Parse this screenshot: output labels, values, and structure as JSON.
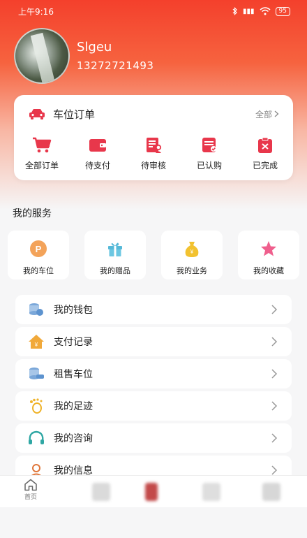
{
  "status_bar": {
    "time": "上午9:16",
    "battery": "95"
  },
  "profile": {
    "name": "Slgeu",
    "phone": "13272721493"
  },
  "order_card": {
    "title": "车位订单",
    "all_label": "全部",
    "items": [
      {
        "label": "全部订单",
        "icon": "cart-icon"
      },
      {
        "label": "待支付",
        "icon": "wallet-icon"
      },
      {
        "label": "待审核",
        "icon": "review-icon"
      },
      {
        "label": "已认购",
        "icon": "subscribed-icon"
      },
      {
        "label": "已完成",
        "icon": "completed-icon"
      }
    ]
  },
  "services": {
    "title": "我的服务",
    "items": [
      {
        "label": "我的车位",
        "icon": "parking-icon"
      },
      {
        "label": "我的赠品",
        "icon": "gift-icon"
      },
      {
        "label": "我的业务",
        "icon": "money-bag-icon"
      },
      {
        "label": "我的收藏",
        "icon": "star-icon"
      }
    ]
  },
  "menu": [
    {
      "label": "我的钱包",
      "icon": "coins-icon"
    },
    {
      "label": "支付记录",
      "icon": "house-yuan-icon"
    },
    {
      "label": "租售车位",
      "icon": "coins-car-icon"
    },
    {
      "label": "我的足迹",
      "icon": "footprint-icon"
    },
    {
      "label": "我的咨询",
      "icon": "consult-icon"
    },
    {
      "label": "我的信息",
      "icon": "user-icon"
    }
  ],
  "bottom_nav": {
    "home_label": "首页"
  },
  "colors": {
    "accent": "#f4402c",
    "icon_red": "#e8374b",
    "text": "#222222"
  }
}
